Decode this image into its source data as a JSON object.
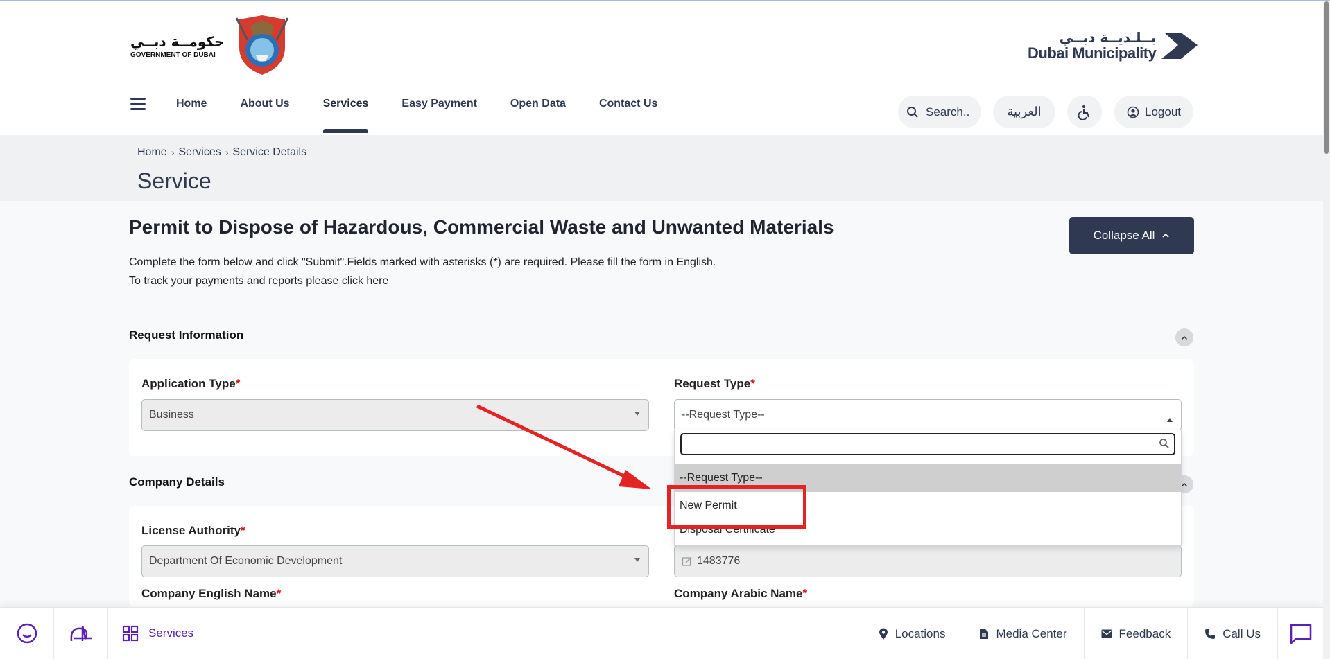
{
  "header": {
    "gov_logo_arabic": "حكومــة دبــي",
    "gov_logo_english": "GOVERNMENT OF DUBAI",
    "dm_logo_arabic": "بــلـديــة دبــي",
    "dm_logo_english": "Dubai Municipality"
  },
  "nav": {
    "items": [
      {
        "label": "Home"
      },
      {
        "label": "About Us"
      },
      {
        "label": "Services",
        "active": true
      },
      {
        "label": "Easy Payment"
      },
      {
        "label": "Open Data"
      },
      {
        "label": "Contact Us"
      }
    ],
    "search_label": "Search..",
    "language_label": "العربية",
    "logout_label": "Logout"
  },
  "breadcrumb": {
    "items": [
      "Home",
      "Services",
      "Service Details"
    ],
    "page_title": "Service"
  },
  "main": {
    "title": "Permit to Dispose of Hazardous, Commercial Waste and Unwanted Materials",
    "intro_line1": "Complete the form below and click \"Submit\".Fields marked with asterisks (*) are required. Please fill the form in English.",
    "intro_line2_prefix": "To track your payments and reports please ",
    "intro_link": "click here",
    "collapse_label": "Collapse All"
  },
  "request_info": {
    "title": "Request Information",
    "application_type_label": "Application Type",
    "application_type_value": "Business",
    "request_type_label": "Request Type",
    "request_type_value": "--Request Type--",
    "dropdown_options": [
      "--Request Type--",
      "New Permit",
      "Disposal Certificate"
    ]
  },
  "company": {
    "title": "Company Details",
    "license_authority_label": "License Authority",
    "license_authority_value": "Department Of Economic Development",
    "license_number_value": "1483776",
    "english_name_label": "Company English Name",
    "arabic_name_label": "Company Arabic Name"
  },
  "bottom_bar": {
    "services_label": "Services",
    "locations_label": "Locations",
    "media_center_label": "Media Center",
    "feedback_label": "Feedback",
    "call_us_label": "Call Us"
  },
  "colors": {
    "brand_navy": "#2f3a52",
    "accent_purple": "#5b21b6",
    "annotation_red": "#e32424",
    "required_red": "#dd1111"
  },
  "icons": [
    "hamburger-icon",
    "search-icon",
    "accessibility-icon",
    "user-icon",
    "chevron-up-icon",
    "magnifier-icon",
    "smile-icon",
    "logo-mark-icon",
    "grid-icon",
    "location-pin-icon",
    "document-icon",
    "mail-icon",
    "phone-icon",
    "chat-icon"
  ]
}
